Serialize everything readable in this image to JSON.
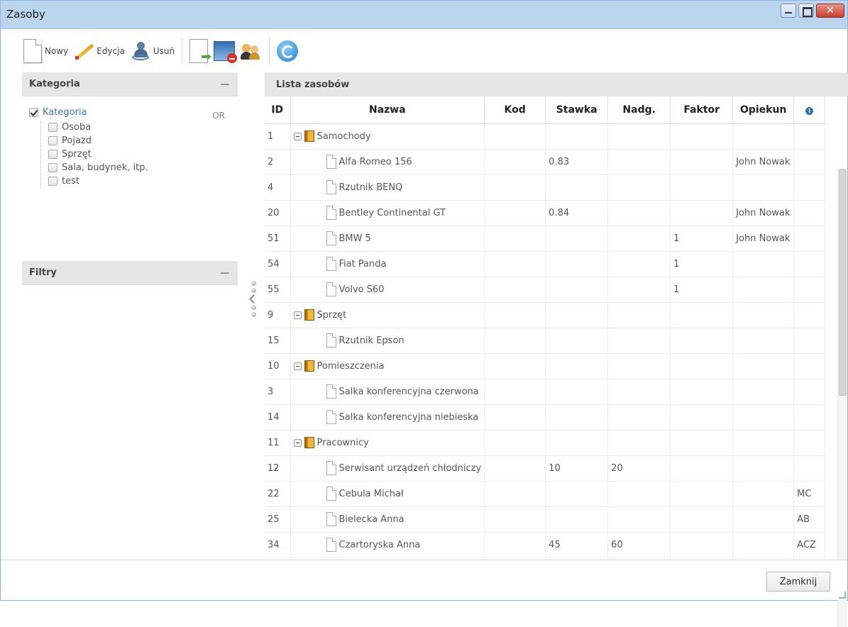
{
  "window": {
    "title": "Zasoby"
  },
  "toolbar": {
    "new_label": "Nowy",
    "edit_label": "Edycja",
    "remove_label": "Usuń",
    "icons": [
      "new-document-icon",
      "pencil-icon",
      "remove-user-icon",
      "export-icon",
      "window-delete-icon",
      "users-icon",
      "refresh-icon"
    ]
  },
  "category_panel": {
    "title": "Kategoria",
    "root_label": "Kategoria",
    "root_checked": true,
    "operator": "OR",
    "items": [
      {
        "label": "Osoba",
        "checked": false
      },
      {
        "label": "Pojazd",
        "checked": false
      },
      {
        "label": "Sprzęt",
        "checked": false
      },
      {
        "label": "Sala, budynek, itp.",
        "checked": false
      },
      {
        "label": "test",
        "checked": false
      }
    ]
  },
  "filters_panel": {
    "title": "Filtry"
  },
  "grid": {
    "title": "Lista zasobów",
    "columns": [
      "ID",
      "Nazwa",
      "Kod",
      "Stawka",
      "Nadg.",
      "Faktor",
      "Opiekun"
    ],
    "info_icon": "info-icon",
    "rows": [
      {
        "id": "1",
        "name": "Samochody",
        "group": true,
        "kod": "",
        "stawka": "",
        "nadg": "",
        "faktor": "",
        "opiekun": "",
        "info": ""
      },
      {
        "id": "2",
        "name": "Alfa Romeo 156",
        "group": false,
        "kod": "",
        "stawka": "0.83",
        "nadg": "",
        "faktor": "",
        "opiekun": "John Nowak",
        "info": ""
      },
      {
        "id": "4",
        "name": "Rzutnik BENQ",
        "group": false,
        "kod": "",
        "stawka": "",
        "nadg": "",
        "faktor": "",
        "opiekun": "",
        "info": ""
      },
      {
        "id": "20",
        "name": "Bentley Continental GT",
        "group": false,
        "kod": "",
        "stawka": "0.84",
        "nadg": "",
        "faktor": "",
        "opiekun": "John Nowak",
        "info": ""
      },
      {
        "id": "51",
        "name": "BMW 5",
        "group": false,
        "kod": "",
        "stawka": "",
        "nadg": "",
        "faktor": "1",
        "opiekun": "John Nowak",
        "info": ""
      },
      {
        "id": "54",
        "name": "Fiat Panda",
        "group": false,
        "kod": "",
        "stawka": "",
        "nadg": "",
        "faktor": "1",
        "opiekun": "",
        "info": ""
      },
      {
        "id": "55",
        "name": "Volvo S60",
        "group": false,
        "kod": "",
        "stawka": "",
        "nadg": "",
        "faktor": "1",
        "opiekun": "",
        "info": ""
      },
      {
        "id": "9",
        "name": "Sprzęt",
        "group": true,
        "kod": "",
        "stawka": "",
        "nadg": "",
        "faktor": "",
        "opiekun": "",
        "info": ""
      },
      {
        "id": "15",
        "name": "Rzutnik Epson",
        "group": false,
        "kod": "",
        "stawka": "",
        "nadg": "",
        "faktor": "",
        "opiekun": "",
        "info": ""
      },
      {
        "id": "10",
        "name": "Pomieszczenia",
        "group": true,
        "kod": "",
        "stawka": "",
        "nadg": "",
        "faktor": "",
        "opiekun": "",
        "info": ""
      },
      {
        "id": "3",
        "name": "Salka konferencyjna czerwona",
        "group": false,
        "kod": "",
        "stawka": "",
        "nadg": "",
        "faktor": "",
        "opiekun": "",
        "info": ""
      },
      {
        "id": "14",
        "name": "Salka konferencyjna niebieska",
        "group": false,
        "kod": "",
        "stawka": "",
        "nadg": "",
        "faktor": "",
        "opiekun": "",
        "info": ""
      },
      {
        "id": "11",
        "name": "Pracownicy",
        "group": true,
        "kod": "",
        "stawka": "",
        "nadg": "",
        "faktor": "",
        "opiekun": "",
        "info": ""
      },
      {
        "id": "12",
        "name": "Serwisant urządzeń chłodniczy",
        "group": false,
        "kod": "",
        "stawka": "10",
        "nadg": "20",
        "faktor": "",
        "opiekun": "",
        "info": ""
      },
      {
        "id": "22",
        "name": "Cebula Michał",
        "group": false,
        "kod": "",
        "stawka": "",
        "nadg": "",
        "faktor": "",
        "opiekun": "",
        "info": "MC"
      },
      {
        "id": "25",
        "name": "Bielecka Anna",
        "group": false,
        "kod": "",
        "stawka": "",
        "nadg": "",
        "faktor": "",
        "opiekun": "",
        "info": "AB"
      },
      {
        "id": "34",
        "name": "Czartoryska Anna",
        "group": false,
        "kod": "",
        "stawka": "45",
        "nadg": "60",
        "faktor": "",
        "opiekun": "",
        "info": "ACZ"
      }
    ]
  },
  "footer": {
    "close_label": "Zamknij"
  },
  "colors": {
    "titlebar": "#bcd5ee",
    "accent": "#3a76b5",
    "close_button": "#c8402f"
  }
}
